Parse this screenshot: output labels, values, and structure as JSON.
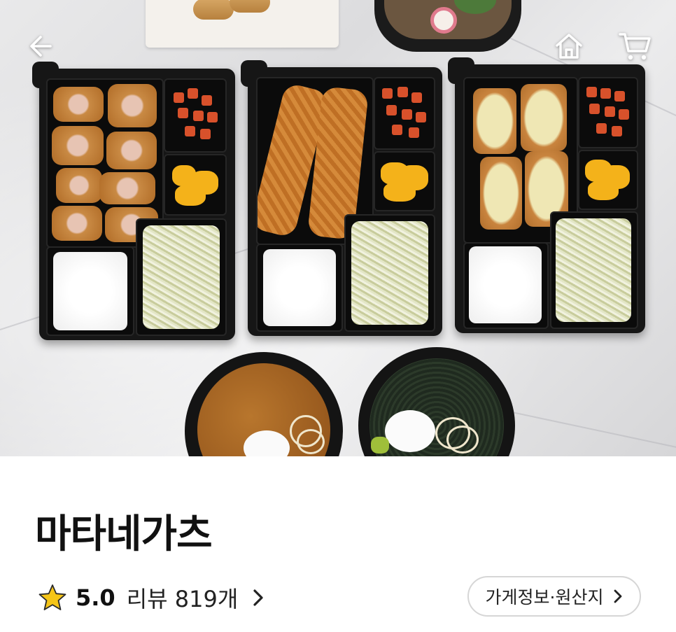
{
  "header": {
    "back_icon": "arrow-left-icon",
    "home_icon": "home-icon",
    "cart_icon": "cart-icon",
    "icon_color": "#ffffff"
  },
  "store": {
    "name": "마타네가츠",
    "rating": "5.0",
    "rating_icon": "star-icon",
    "star_color": "#f5c518",
    "review_label": "리뷰 819개",
    "info_button_label": "가게정보·원산지"
  }
}
